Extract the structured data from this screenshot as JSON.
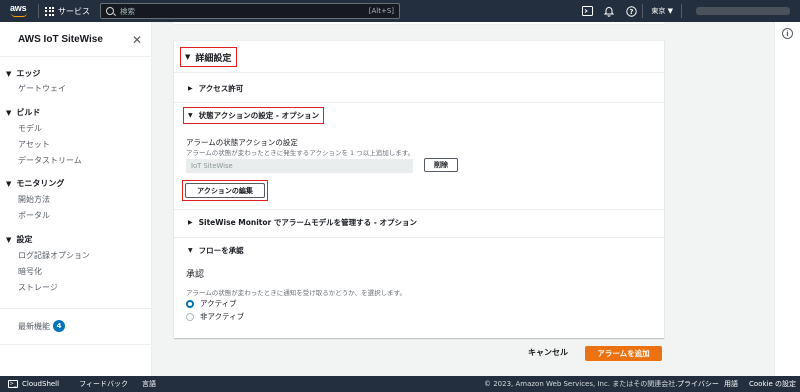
{
  "topnav": {
    "logo_text": "aws",
    "services_label": "サービス",
    "search_placeholder": "検索",
    "search_shortcut": "[Alt+S]",
    "region_label": "東京 ▼"
  },
  "sidebar": {
    "title": "AWS IoT SiteWise",
    "groups": [
      {
        "label": "エッジ",
        "items": [
          "ゲートウェイ"
        ]
      },
      {
        "label": "ビルド",
        "items": [
          "モデル",
          "アセット",
          "データストリーム"
        ]
      },
      {
        "label": "モニタリング",
        "items": [
          "開始方法",
          "ポータル"
        ]
      },
      {
        "label": "設定",
        "items": [
          "ログ記録オプション",
          "暗号化",
          "ストレージ"
        ]
      }
    ],
    "new_features_label": "最新機能",
    "new_features_count": "4"
  },
  "main": {
    "section_title": "詳細設定",
    "access_permission": "アクセス許可",
    "state_action_title": "状態アクションの設定 - オプション",
    "state_action_label": "アラームの状態アクションの設定",
    "state_action_desc": "アラームの状態が変わったときに発生するアクションを 1 つ以上追加します。",
    "action_value": "IoT SiteWise",
    "delete_button": "削除",
    "edit_action_button": "アクションの編集",
    "sitewise_monitor_title": "SiteWise Monitor でアラームモデルを管理する - オプション",
    "flow_approval_title": "フローを承認",
    "approval_heading": "承認",
    "approval_desc": "アラームの状態が変わったときに通知を受け取るかどうか、を選択します。",
    "radio_active": "アクティブ",
    "radio_inactive": "非アクティブ",
    "cancel_button": "キャンセル",
    "add_alarm_button": "アラームを追加"
  },
  "bottombar": {
    "cloudshell": "CloudShell",
    "feedback": "フィードバック",
    "language": "言語",
    "copyright": "© 2023, Amazon Web Services, Inc. またはその関連会社.",
    "privacy": "プライバシー",
    "terms": "用語",
    "cookie": "Cookie の設定"
  },
  "colors": {
    "nav_bg": "#232f3e",
    "primary": "#ec7211",
    "link_blue": "#0073bb",
    "highlight_red": "#e02020"
  }
}
